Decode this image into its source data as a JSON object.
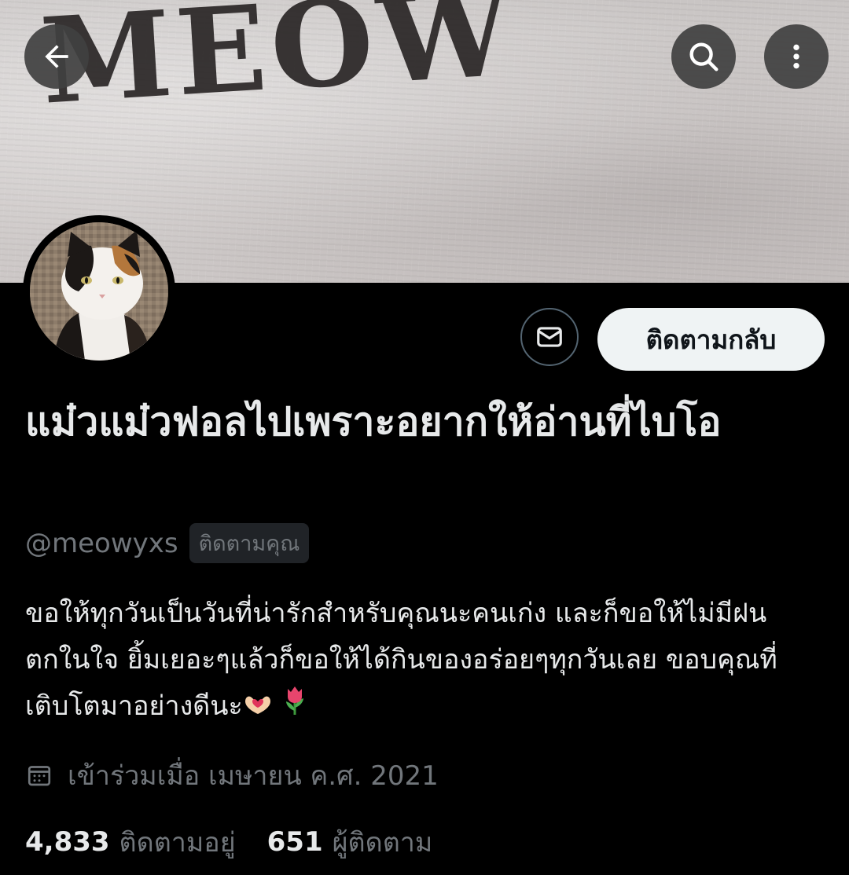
{
  "banner": {
    "text": "MEOW"
  },
  "header": {
    "back_icon": "arrow-left-icon",
    "search_icon": "search-icon",
    "more_icon": "more-vertical-icon"
  },
  "profile": {
    "display_name": "แม๋วแม๋วฟอลไปเพราะอยากให้อ่านที่ไบโอ",
    "handle": "@meowyxs",
    "follows_you_badge": "ติดตามคุณ",
    "bio": "ขอให้ทุกวันเป็นวันที่น่ารักสำหรับคุณนะคนเก่ง และก็ขอให้ไม่มีฝนตกในใจ ยิ้มเยอะๆแล้วก็ขอให้ได้กินของอร่อยๆทุกวันเลย ขอบคุณที่เติบโตมาอย่างดีนะ",
    "bio_emojis": [
      "heart-hands-icon",
      "tulip-icon"
    ],
    "joined_text": "เข้าร่วมเมื่อ เมษายน ค.ศ. 2021",
    "following_count": "4,833",
    "following_label": "ติดตามอยู่",
    "followers_count": "651",
    "followers_label": "ผู้ติดตาม"
  },
  "actions": {
    "message_icon": "envelope-icon",
    "follow_back_label": "ติดตามกลับ"
  },
  "colors": {
    "background": "#000000",
    "primary_text": "#e7e9ea",
    "secondary_text": "#71767b",
    "button_bg": "#eff3f4",
    "border": "#536471"
  }
}
